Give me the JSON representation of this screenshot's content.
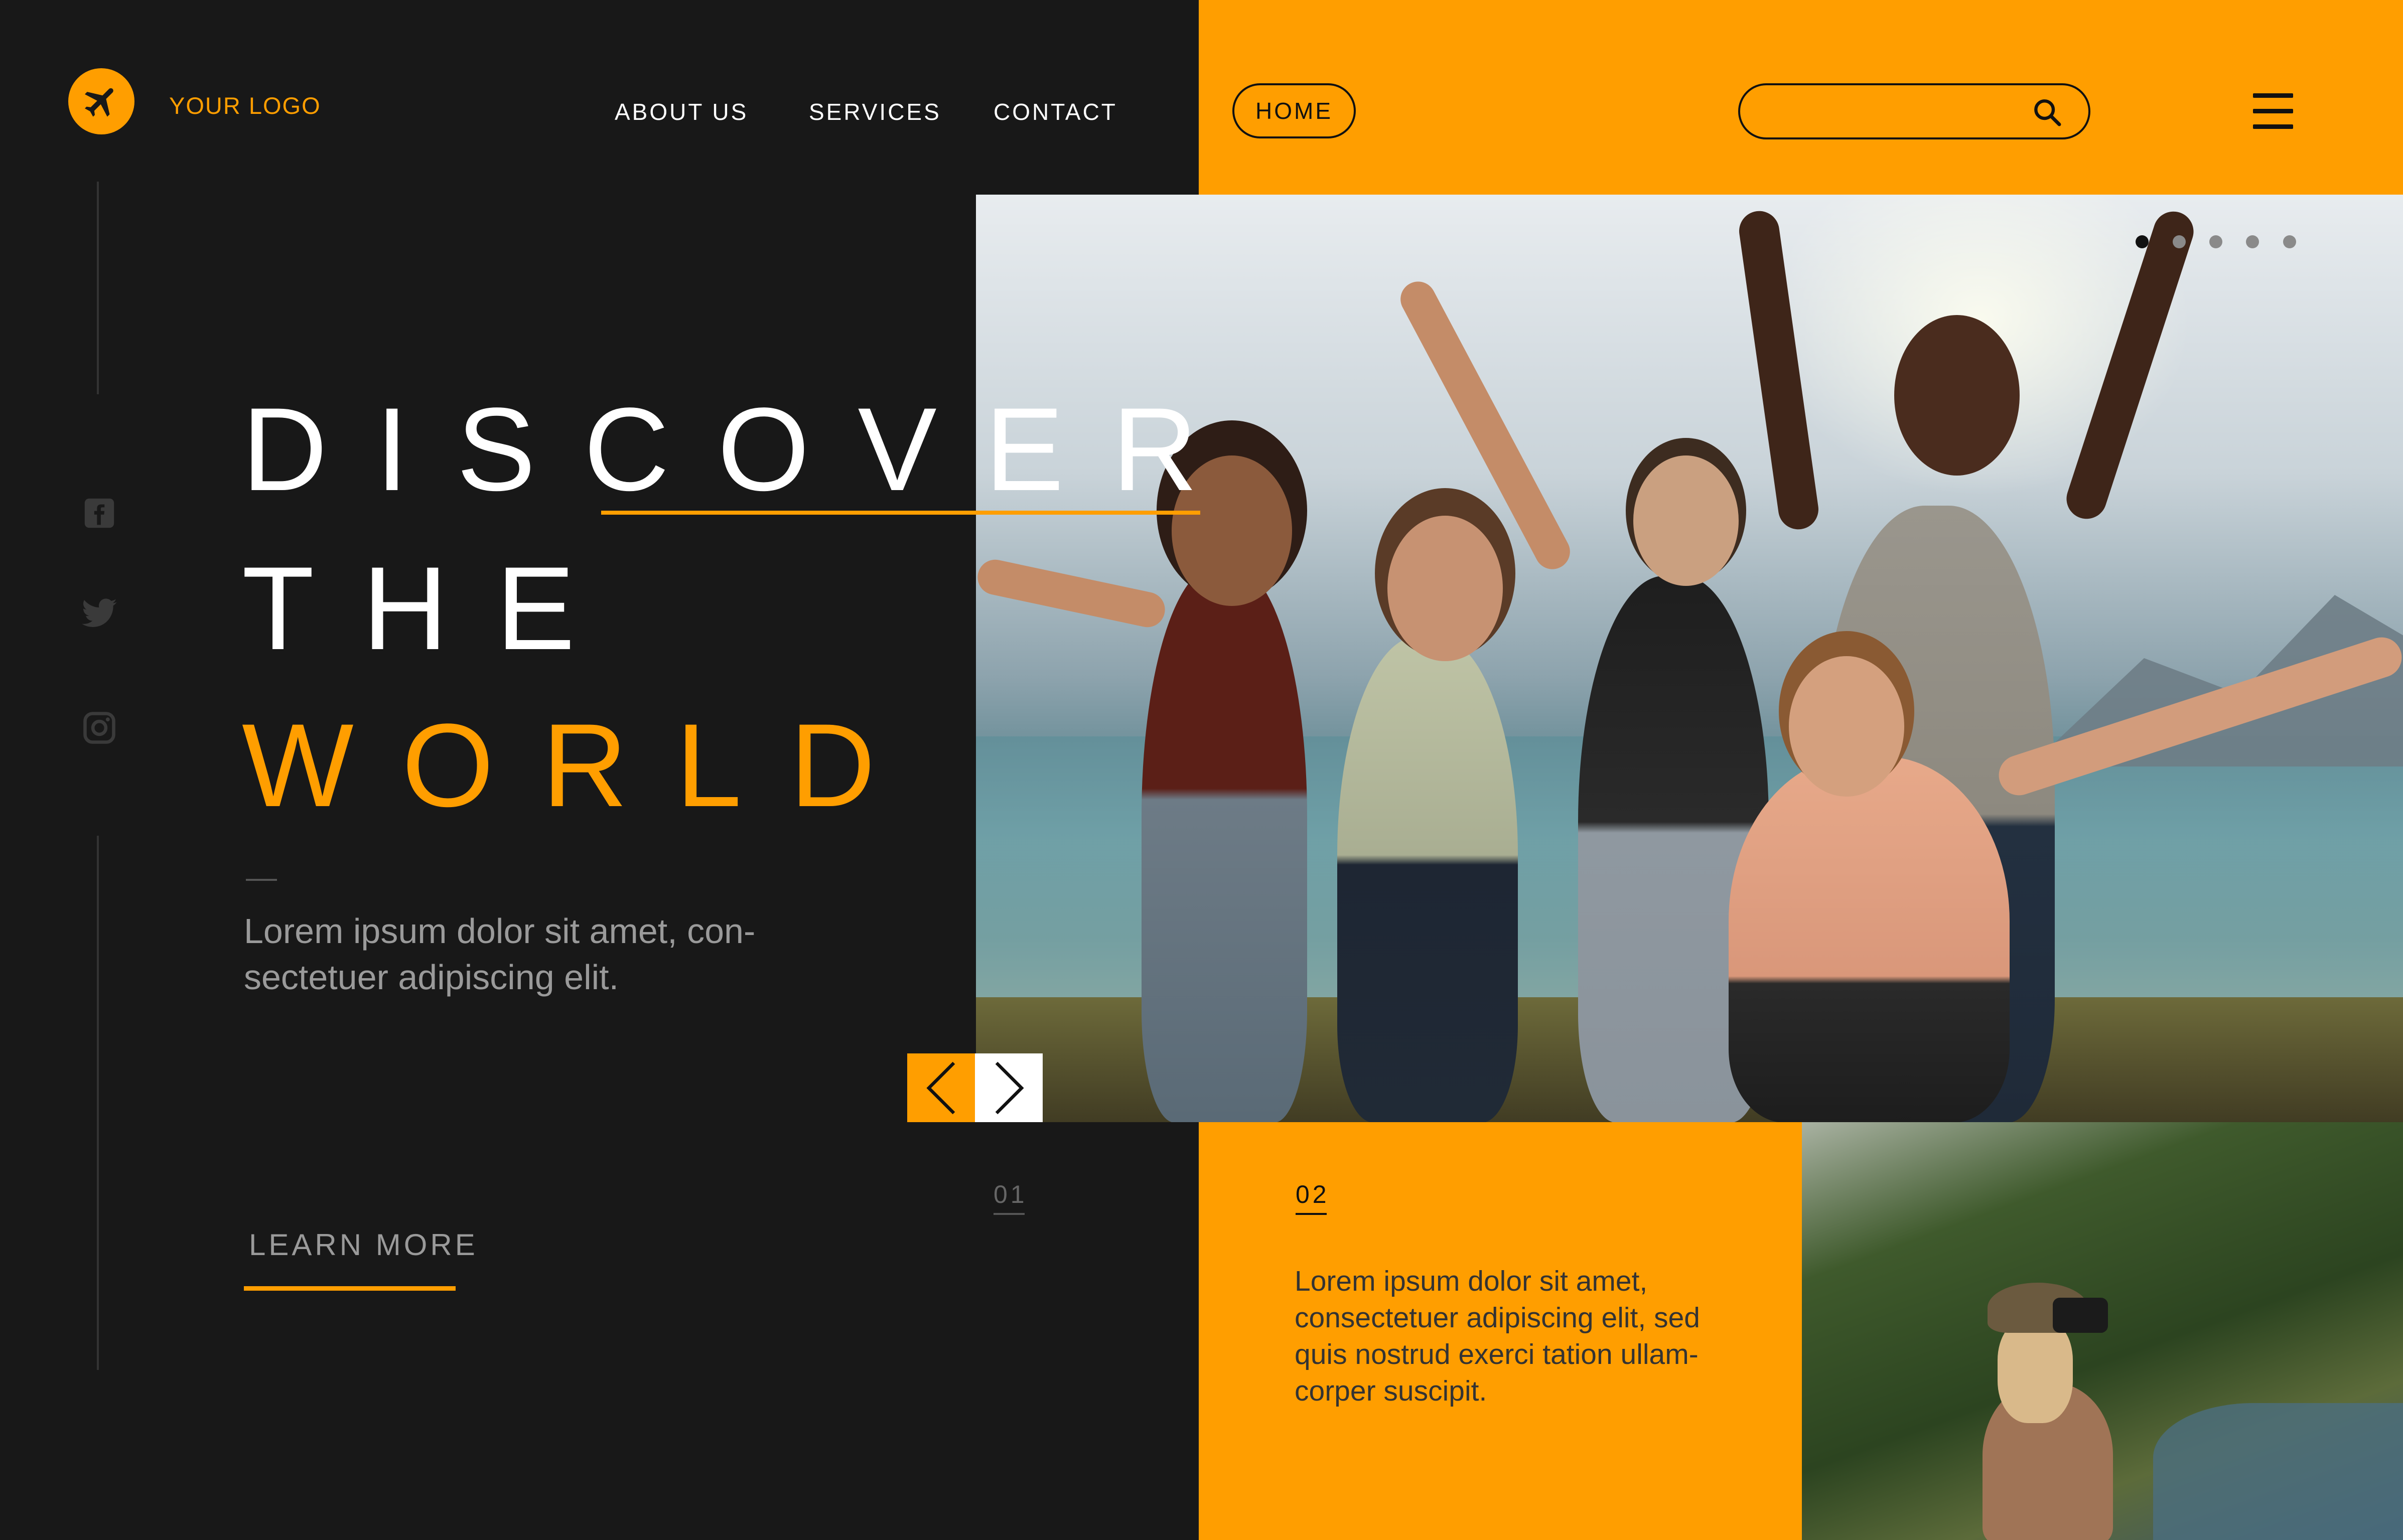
{
  "header": {
    "logo_text": "YOUR LOGO",
    "nav": [
      "ABOUT US",
      "SERVICES",
      "CONTACT"
    ],
    "home_label": "HOME",
    "search_placeholder": ""
  },
  "hero": {
    "title_line1": "DISCOVER",
    "title_line2": "THE",
    "title_line3": "WORLD",
    "description_line1": "Lorem ipsum dolor sit amet, con-",
    "description_line2": "sectetuer adipiscing elit.",
    "learn_more": "LEARN MORE",
    "slide_index": "01",
    "carousel_dots": 5,
    "active_dot": 0
  },
  "card": {
    "slide_index": "02",
    "text_line1": "Lorem ipsum dolor sit amet,",
    "text_line2": "consectetuer adipiscing elit, sed",
    "text_line3": "quis nostrud exerci tation ullam-",
    "text_line4": "corper suscipit."
  },
  "colors": {
    "accent": "#ff9e00",
    "dark": "#181818",
    "white": "#ffffff"
  },
  "icons": [
    "airplane-icon",
    "facebook-icon",
    "twitter-icon",
    "instagram-icon",
    "search-icon",
    "menu-icon",
    "chevron-left-icon",
    "chevron-right-icon"
  ]
}
